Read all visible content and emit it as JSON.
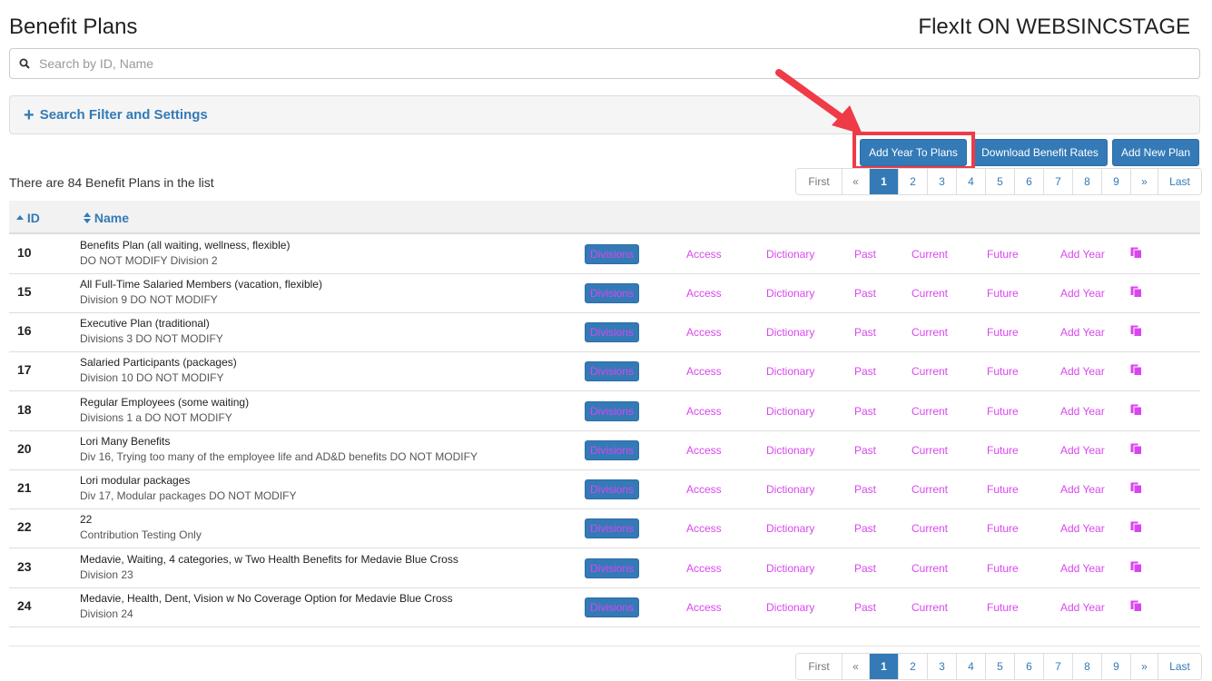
{
  "header": {
    "page_title": "Benefit Plans",
    "app_title": "FlexIt ON WEBSINCSTAGE"
  },
  "search": {
    "placeholder": "Search by ID, Name",
    "value": ""
  },
  "filter": {
    "label": "Search Filter and Settings"
  },
  "toolbar": {
    "add_year_label": "Add Year To Plans",
    "download_label": "Download Benefit Rates",
    "add_plan_label": "Add New Plan"
  },
  "summary": {
    "count_text": "There are 84 Benefit Plans in the list"
  },
  "pagination": {
    "first": "First",
    "prev": "«",
    "pages": [
      "1",
      "2",
      "3",
      "4",
      "5",
      "6",
      "7",
      "8",
      "9"
    ],
    "current": "1",
    "next": "»",
    "last": "Last"
  },
  "table": {
    "col_id": "ID",
    "col_name": "Name",
    "action_labels": {
      "divisions": "Divisions",
      "access": "Access",
      "dictionary": "Dictionary",
      "past": "Past",
      "current": "Current",
      "future": "Future",
      "add_year": "Add Year"
    },
    "rows": [
      {
        "id": "10",
        "name": "Benefits Plan (all waiting, wellness, flexible)",
        "desc": "DO NOT MODIFY Division 2"
      },
      {
        "id": "15",
        "name": "All Full-Time Salaried Members (vacation, flexible)",
        "desc": "Division 9 DO NOT MODIFY"
      },
      {
        "id": "16",
        "name": "Executive Plan (traditional)",
        "desc": "Divisions 3 DO NOT MODIFY"
      },
      {
        "id": "17",
        "name": "Salaried Participants (packages)",
        "desc": "Division 10 DO NOT MODIFY"
      },
      {
        "id": "18",
        "name": "Regular Employees (some waiting)",
        "desc": "Divisions 1 a DO NOT MODIFY"
      },
      {
        "id": "20",
        "name": "Lori Many Benefits",
        "desc": "Div 16, Trying too many of the employee life and AD&D benefits DO NOT MODIFY"
      },
      {
        "id": "21",
        "name": "Lori modular packages",
        "desc": "Div 17, Modular packages DO NOT MODIFY"
      },
      {
        "id": "22",
        "name": "22",
        "desc": "Contribution Testing Only"
      },
      {
        "id": "23",
        "name": "Medavie, Waiting, 4 categories, w Two Health Benefits for Medavie Blue Cross",
        "desc": "Division 23"
      },
      {
        "id": "24",
        "name": "Medavie, Health, Dent, Vision w No Coverage Option for Medavie Blue Cross",
        "desc": "Division 24"
      }
    ]
  },
  "colors": {
    "brand_blue": "#337ab7",
    "link_magenta": "#d946ef",
    "highlight_red": "#ef3b47"
  },
  "icons": [
    "search-icon",
    "plus-icon",
    "sort-asc-icon",
    "sort-icon",
    "copy-icon",
    "arrow-annotation"
  ]
}
